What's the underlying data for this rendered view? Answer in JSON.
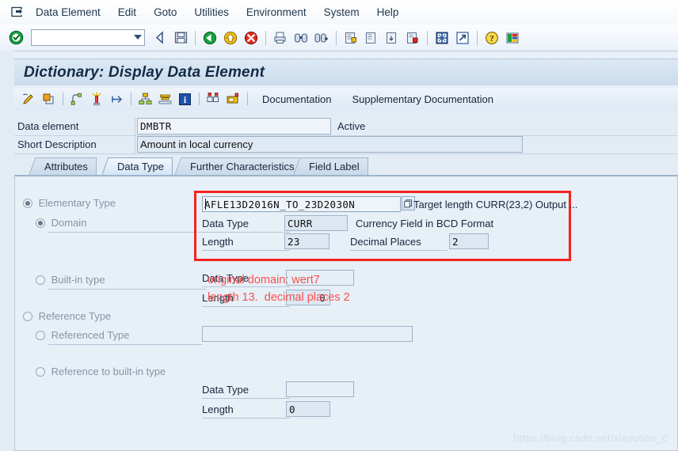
{
  "window": {
    "system_icon": "system-menu-icon"
  },
  "menu": {
    "items": [
      {
        "label": "Data Element",
        "accel": "D"
      },
      {
        "label": "Edit",
        "accel": "E"
      },
      {
        "label": "Goto",
        "accel": "G"
      },
      {
        "label": "Utilities",
        "accel": "s"
      },
      {
        "label": "Environment",
        "accel": "n"
      },
      {
        "label": "System",
        "accel": "y"
      },
      {
        "label": "Help",
        "accel": "H"
      }
    ]
  },
  "toolbar": {
    "enter_icon": "green-check-icon",
    "command_field": {
      "value": "",
      "placeholder": ""
    },
    "buttons": [
      "back-arrow-icon",
      "save-icon",
      "back-green-icon",
      "exit-yellow-icon",
      "cancel-red-icon",
      "print-icon",
      "find-icon",
      "find-next-icon",
      "first-page-icon",
      "previous-page-icon",
      "next-page-icon",
      "last-page-icon",
      "create-session-icon",
      "create-shortcut-icon",
      "help-icon",
      "customize-icon"
    ]
  },
  "title": "Dictionary: Display Data Element",
  "app_toolbar": {
    "icons": [
      "display-change-icon",
      "other-object-icon",
      "copy-object-icon",
      "where-used-list-icon",
      "expand-icon",
      "hierarchy-icon",
      "stack-icon",
      "info-icon",
      "technical-settings-icon",
      "append-icon"
    ],
    "links": [
      "Documentation",
      "Supplementary Documentation"
    ]
  },
  "header": {
    "data_element_label": "Data element",
    "data_element_value": "DMBTR",
    "status": "Active",
    "short_description_label": "Short Description",
    "short_description_value": "Amount in local currency"
  },
  "tabs": [
    {
      "label": "Attributes",
      "selected": false
    },
    {
      "label": "Data Type",
      "selected": true
    },
    {
      "label": "Further Characteristics",
      "selected": false
    },
    {
      "label": "Field Label",
      "selected": false
    }
  ],
  "data_type_tab": {
    "elementary_type_label": "Elementary Type",
    "domain_label": "Domain",
    "domain_value": "AFLE13D2016N_TO_23D2030N",
    "domain_dropdown_icon": "value-help-icon",
    "domain_hint": "Target length CURR(23,2) Output ...",
    "domain_data_type_label": "Data Type",
    "domain_data_type_value": "CURR",
    "domain_data_type_desc": "Currency Field in BCD Format",
    "domain_length_label": "Length",
    "domain_length_value": "23",
    "domain_decimals_label": "Decimal Places",
    "domain_decimals_value": "2",
    "builtin_type_label": "Built-in type",
    "builtin_data_type_label": "Data Type",
    "builtin_data_type_value": "",
    "builtin_length_label": "Length",
    "builtin_length_value": "0",
    "reference_type_label": "Reference Type",
    "referenced_type_label": "Referenced Type",
    "referenced_type_value": "",
    "reference_builtin_label": "Reference to built-in type",
    "ref_builtin_data_type_label": "Data Type",
    "ref_builtin_data_type_value": "",
    "ref_builtin_length_label": "Length",
    "ref_builtin_length_value": "0"
  },
  "annotation": {
    "line1": "original domain: wert7",
    "line2": "length 13.  decimal places 2",
    "color": "#fa5050"
  },
  "watermark": "https://blog.csdn.net/xiayutian_c"
}
